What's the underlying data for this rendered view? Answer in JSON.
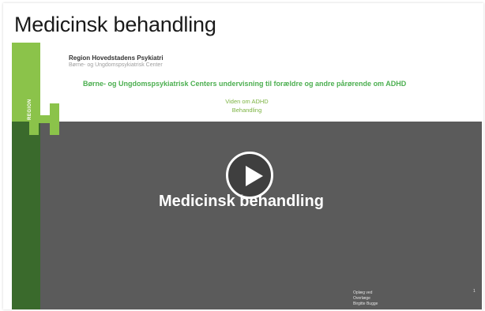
{
  "page": {
    "title": "Medicinsk behandling"
  },
  "video": {
    "slide": {
      "org_name": "Region Hovedstadens Psykiatri",
      "org_sub": "Børne- og Ungdomspsykiatrisk Center",
      "logo_text": "REGION",
      "headline": "Børne- og Ungdomspsykiatrisk Centers undervisning til forældre og andre pårørende om ADHD",
      "topic_line1": "Viden om ADHD",
      "topic_line2": "Behandling",
      "big_title": "Medicinsk behandling",
      "presenter_line1": "Oplæg ved",
      "presenter_line2": "Overlæge",
      "presenter_line3": "Birgitte Bugge",
      "slide_number": "1"
    },
    "play_icon": "play-icon",
    "colors": {
      "slide_background": "#5b5b5b",
      "brand_green_light": "#8bc34a",
      "brand_green_dark": "#3a6a2c",
      "headline_green": "#4caf50"
    }
  }
}
